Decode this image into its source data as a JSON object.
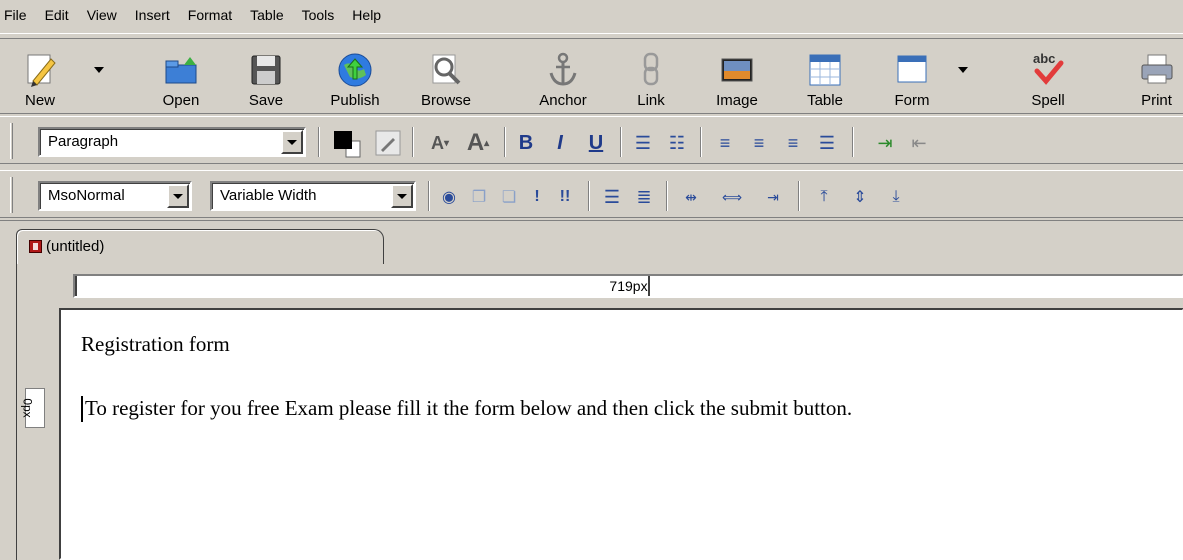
{
  "menu": [
    "File",
    "Edit",
    "View",
    "Insert",
    "Format",
    "Table",
    "Tools",
    "Help"
  ],
  "toolbar": {
    "new": "New",
    "open": "Open",
    "save": "Save",
    "publish": "Publish",
    "browse": "Browse",
    "anchor": "Anchor",
    "link": "Link",
    "image": "Image",
    "table": "Table",
    "form": "Form",
    "spell": "Spell",
    "spell_icon_text": "abc",
    "print": "Print"
  },
  "format_bar": {
    "paragraph_style": "Paragraph",
    "bold": "B",
    "italic": "I",
    "underline": "U"
  },
  "format_bar2": {
    "class": "MsoNormal",
    "width_mode": "Variable Width"
  },
  "tab": {
    "title": "(untitled)"
  },
  "rulers": {
    "horizontal": "719px",
    "vertical": "0px"
  },
  "document": {
    "line1": "Registration form",
    "line2": "To register for you free Exam please fill it the form below and then click the submit button."
  },
  "colors": {
    "chrome": "#d4d0c8",
    "accent_blue": "#1f3a8a"
  }
}
